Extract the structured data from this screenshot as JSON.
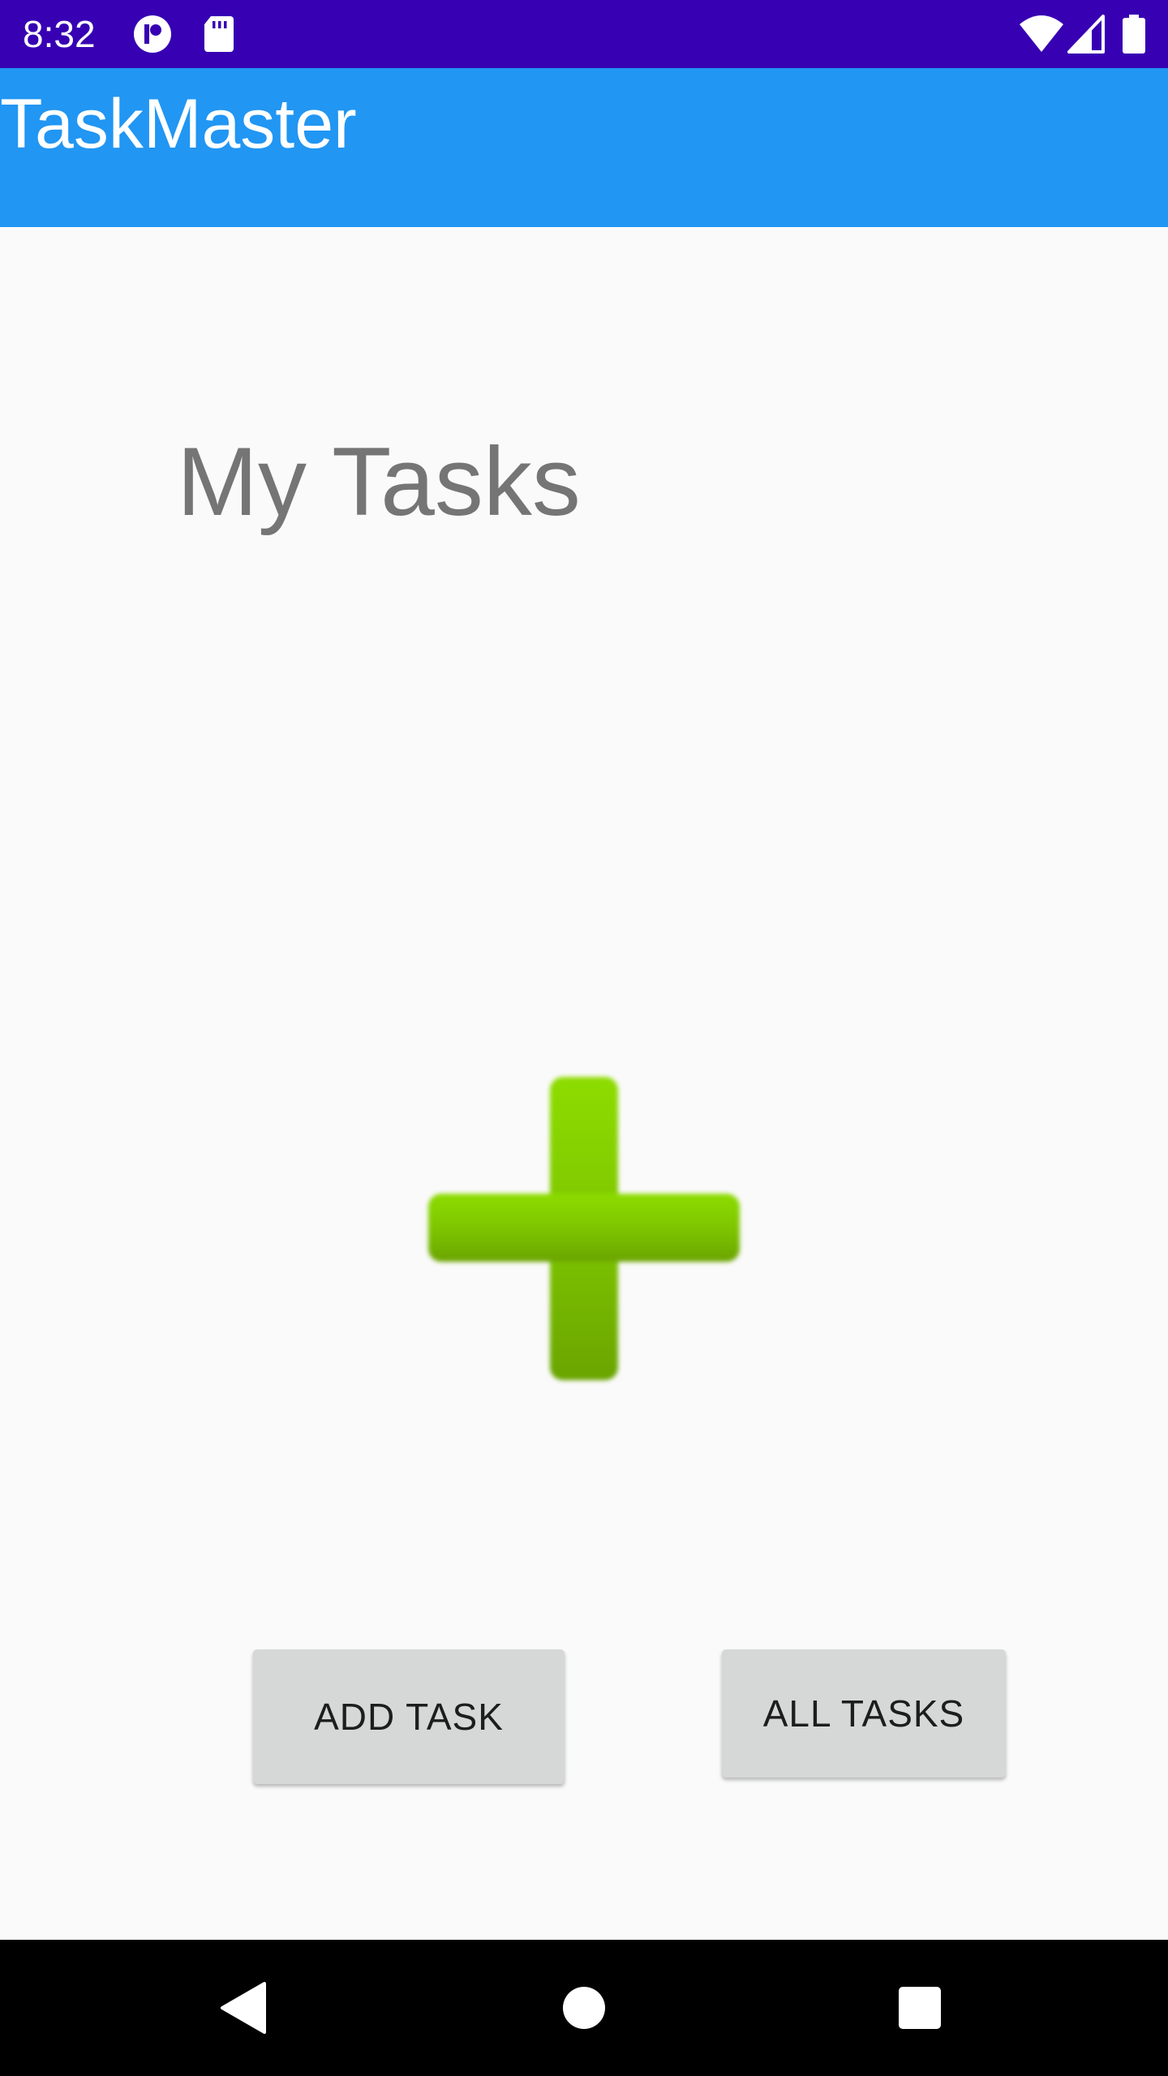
{
  "status_bar": {
    "time": "8:32",
    "background": "#3700b3",
    "left_icons": [
      "app-notification-icon",
      "sd-card-icon"
    ],
    "right_icons": [
      "wifi-icon",
      "cell-signal-icon",
      "battery-icon"
    ]
  },
  "app_bar": {
    "title": "TaskMaster",
    "background": "#2196f3"
  },
  "main": {
    "heading": "My Tasks",
    "image": "green-plus-icon",
    "buttons": {
      "add_task": "ADD TASK",
      "all_tasks": "ALL TASKS"
    }
  },
  "nav_bar": {
    "icons": [
      "back-icon",
      "home-icon",
      "recents-icon"
    ]
  }
}
